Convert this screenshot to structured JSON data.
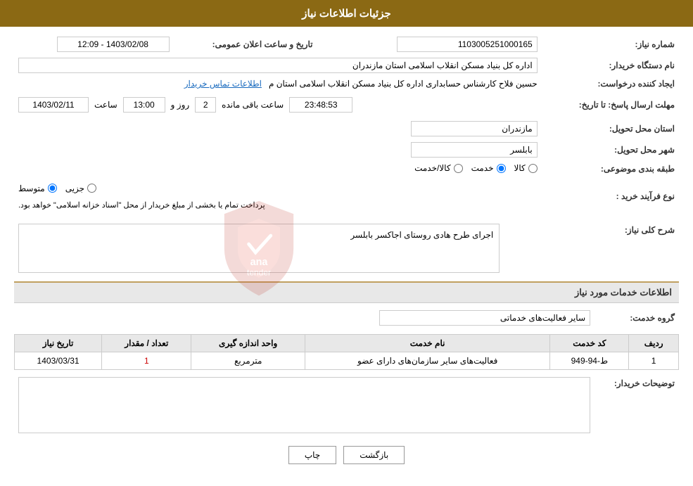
{
  "page": {
    "title": "جزئیات اطلاعات نیاز"
  },
  "header": {
    "title": "جزئیات اطلاعات نیاز"
  },
  "fields": {
    "need_number_label": "شماره نیاز:",
    "need_number_value": "1103005251000165",
    "date_label": "تاریخ و ساعت اعلان عمومی:",
    "date_value": "1403/02/08 - 12:09",
    "buyer_org_label": "نام دستگاه خریدار:",
    "buyer_org_value": "اداره کل بنیاد مسکن انقلاب اسلامی استان مازندران",
    "creator_label": "ایجاد کننده درخواست:",
    "creator_value": "حسین فلاح کارشناس حسابداری اداره کل بنیاد مسکن انقلاب اسلامی استان م",
    "contact_link": "اطلاعات تماس خریدار",
    "deadline_label": "مهلت ارسال پاسخ: تا تاریخ:",
    "deadline_date": "1403/02/11",
    "deadline_time_label": "ساعت",
    "deadline_time": "13:00",
    "deadline_day_label": "روز و",
    "deadline_days": "2",
    "deadline_remaining_label": "ساعت باقی مانده",
    "deadline_remaining": "23:48:53",
    "province_label": "استان محل تحویل:",
    "province_value": "مازندران",
    "city_label": "شهر محل تحویل:",
    "city_value": "بابلسر",
    "category_label": "طبقه بندی موضوعی:",
    "category_options": [
      "کالا",
      "خدمت",
      "کالا/خدمت"
    ],
    "category_selected": "خدمت",
    "purchase_type_label": "نوع فرآیند خرید :",
    "purchase_options": [
      "جزیی",
      "متوسط"
    ],
    "purchase_note": "پرداخت تمام یا بخشی از مبلغ خریدار از محل \"اسناد خزانه اسلامی\" خواهد بود.",
    "description_label": "شرح کلی نیاز:",
    "description_value": "اجرای طرح هادی روستای اجاکسر بابلسر",
    "services_section_label": "اطلاعات خدمات مورد نیاز",
    "service_group_label": "گروه خدمت:",
    "service_group_value": "سایر فعالیت‌های خدماتی",
    "table": {
      "headers": [
        "ردیف",
        "کد خدمت",
        "نام خدمت",
        "واحد اندازه گیری",
        "تعداد / مقدار",
        "تاریخ نیاز"
      ],
      "rows": [
        {
          "row": "1",
          "code": "ط-94-949",
          "name": "فعالیت‌های سایر سازمان‌های دارای عضو",
          "unit": "مترمربع",
          "quantity": "1",
          "date": "1403/03/31"
        }
      ]
    },
    "buyer_notes_label": "توضیحات خریدار:"
  },
  "buttons": {
    "print": "چاپ",
    "back": "بازگشت"
  }
}
